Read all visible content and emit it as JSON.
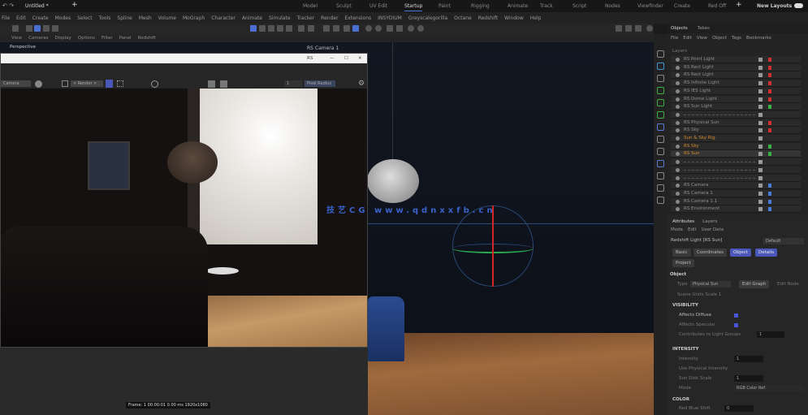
{
  "topbar": {
    "doc_title": "Untitled *",
    "tabs": [
      "Model",
      "Sculpt",
      "UV Edit",
      "Startup",
      "Paint",
      "Rigging",
      "Animate",
      "Track",
      "Script",
      "Nodes",
      "Viewfinder",
      "Create",
      "Red Off"
    ],
    "active_tab": "Startup",
    "new_layouts": "New Layouts"
  },
  "menubar": [
    "File",
    "Edit",
    "Create",
    "Modes",
    "Select",
    "Tools",
    "Spline",
    "Mesh",
    "Volume",
    "MoGraph",
    "Character",
    "Animate",
    "Simulate",
    "Tracker",
    "Render",
    "Extensions",
    "INSYDIUM",
    "Greyscalegorilla",
    "Octane",
    "Redshift",
    "Window",
    "Help"
  ],
  "viewport": {
    "menu": [
      "View",
      "Cameras",
      "Display",
      "Options",
      "Filter",
      "Panel",
      "Redshift"
    ],
    "label": "Perspective",
    "camera": "RS Camera 1"
  },
  "render_window": {
    "title": "RS",
    "camera_select": "Camera",
    "snapshot_select": "< Render >",
    "mode": "Pixel Radius",
    "value": "1",
    "status": "Frame: 1  00:00:01  0.00 ms  1920x1080"
  },
  "watermark": "技艺CG  www.qdnxxfb.cn",
  "objects": {
    "tabs": [
      "Objects",
      "Takes"
    ],
    "menu": [
      "File",
      "Edit",
      "View",
      "Object",
      "Tags",
      "Bookmarks"
    ],
    "header": "Layers",
    "items": [
      {
        "name": "RS Point Light",
        "tag": "#d03030"
      },
      {
        "name": "RS Rect Light",
        "tag": "#d03030"
      },
      {
        "name": "RS Rect Light",
        "tag": "#d03030"
      },
      {
        "name": "RS Infinite Light",
        "tag": "#d03030"
      },
      {
        "name": "RS IES Light",
        "tag": "#d03030"
      },
      {
        "name": "RS Dome Light",
        "tag": "#d03030"
      },
      {
        "name": "RS Sun Light",
        "tag": "#3ab040"
      },
      {
        "name": "",
        "tag": ""
      },
      {
        "name": "RS Physical Sun",
        "tag": "#d03030"
      },
      {
        "name": "RS Sky",
        "tag": "#d03030"
      },
      {
        "name": "Sun & Sky Rig",
        "tag": "",
        "highlight": true
      },
      {
        "name": "RS Sky",
        "tag": "#3ab040",
        "highlight": true
      },
      {
        "name": "RS Sun",
        "tag": "#3ab040",
        "highlight": true
      },
      {
        "name": "",
        "tag": ""
      },
      {
        "name": "",
        "tag": ""
      },
      {
        "name": "",
        "tag": ""
      },
      {
        "name": "RS Camera",
        "tag": "#4a7bd8"
      },
      {
        "name": "RS Camera 1",
        "tag": "#4a7bd8"
      },
      {
        "name": "RS Camera 1.1",
        "tag": "#4a7bd8"
      },
      {
        "name": "RS Environment",
        "tag": "#4a7bd8"
      }
    ]
  },
  "attributes": {
    "tabs": [
      "Attributes",
      "Layers"
    ],
    "menu": [
      "Mode",
      "Edit",
      "User Data"
    ],
    "object_title": "Redshift Light [RS Sun]",
    "mode_select": "Default",
    "buttons": [
      "Basic",
      "Coordinates",
      "Object",
      "Details",
      "Project"
    ],
    "active_buttons": [
      "Object",
      "Details"
    ],
    "section_object": "Object",
    "type_label": "Type",
    "type_value": "Physical Sun",
    "edit_graph": "Edit Graph",
    "edit_node": "Edit Node",
    "scene_units": "Scene Units Scale 1",
    "section_visibility": "VISIBILITY",
    "visibility": [
      {
        "label": "Affects Diffuse",
        "checked": true
      },
      {
        "label": "Affects Specular",
        "checked": true
      },
      {
        "label": "Contributes to Light Groups",
        "value": "1"
      }
    ],
    "section_intensity": "INTENSITY",
    "intensity": [
      {
        "label": "Intensity",
        "value": "1"
      },
      {
        "label": "Use Physical Intensity",
        "value": ""
      },
      {
        "label": "Sun Disk Scale",
        "value": "1"
      },
      {
        "label": "Mode",
        "value": "RGB Color Ref"
      }
    ],
    "section_color": "COLOR",
    "color": [
      {
        "label": "Red Blue Shift",
        "value": "0"
      }
    ]
  }
}
